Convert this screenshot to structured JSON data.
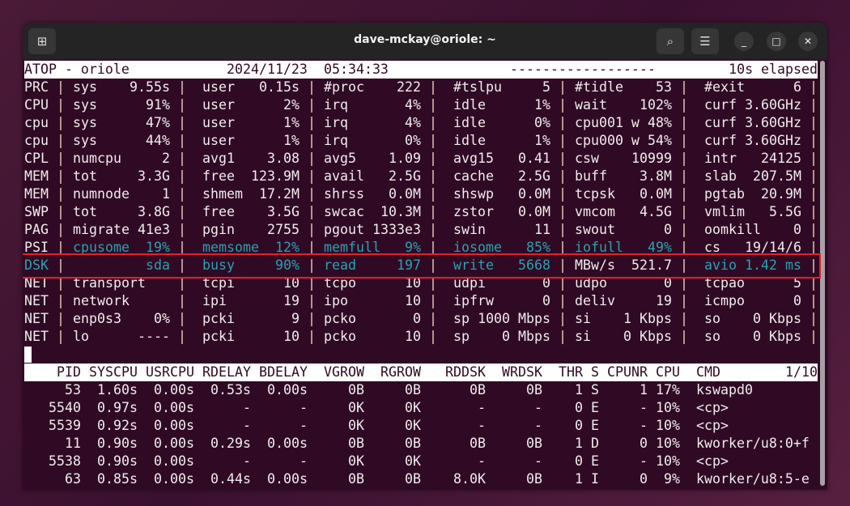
{
  "window": {
    "title": "dave-mckay@oriole: ~",
    "icons": {
      "new_tab": "new-tab-icon",
      "search": "search-icon",
      "menu": "hamburger-menu-icon",
      "minimize": "minimize-icon",
      "maximize": "maximize-icon",
      "close": "close-icon"
    }
  },
  "colors": {
    "terminal_bg": "#300a24",
    "highlight_text": "#2aa1b3",
    "annotation_box": "#e0202c"
  },
  "header": {
    "left": "ATOP - oriole",
    "date": "2024/11/23",
    "time": "05:34:33",
    "dashes": "------------------",
    "elapsed": "10s elapsed"
  },
  "system_rows": [
    {
      "label": "PRC",
      "cells": [
        [
          "sys",
          "9.55s"
        ],
        [
          "user",
          "0.15s"
        ],
        [
          "#proc",
          "222"
        ],
        [
          "#tslpu",
          "5"
        ],
        [
          "#tidle",
          "53"
        ],
        [
          "#exit",
          "6"
        ]
      ]
    },
    {
      "label": "CPU",
      "cells": [
        [
          "sys",
          "91%"
        ],
        [
          "user",
          "2%"
        ],
        [
          "irq",
          "4%"
        ],
        [
          "idle",
          "1%"
        ],
        [
          "wait",
          "102%"
        ],
        [
          "curf",
          "3.60GHz"
        ]
      ]
    },
    {
      "label": "cpu",
      "cells": [
        [
          "sys",
          "47%"
        ],
        [
          "user",
          "1%"
        ],
        [
          "irq",
          "4%"
        ],
        [
          "idle",
          "0%"
        ],
        [
          "cpu001 w",
          "48%"
        ],
        [
          "curf",
          "3.60GHz"
        ]
      ]
    },
    {
      "label": "cpu",
      "cells": [
        [
          "sys",
          "44%"
        ],
        [
          "user",
          "1%"
        ],
        [
          "irq",
          "0%"
        ],
        [
          "idle",
          "1%"
        ],
        [
          "cpu000 w",
          "54%"
        ],
        [
          "curf",
          "3.60GHz"
        ]
      ]
    },
    {
      "label": "CPL",
      "cells": [
        [
          "numcpu",
          "2"
        ],
        [
          "avg1",
          "3.08"
        ],
        [
          "avg5",
          "1.09"
        ],
        [
          "avg15",
          "0.41"
        ],
        [
          "csw",
          "10999"
        ],
        [
          "intr",
          "24125"
        ]
      ]
    },
    {
      "label": "MEM",
      "cells": [
        [
          "tot",
          "3.3G"
        ],
        [
          "free",
          "123.9M"
        ],
        [
          "avail",
          "2.5G"
        ],
        [
          "cache",
          "2.5G"
        ],
        [
          "buff",
          "3.8M"
        ],
        [
          "slab",
          "207.5M"
        ]
      ]
    },
    {
      "label": "MEM",
      "cells": [
        [
          "numnode",
          "1"
        ],
        [
          "shmem",
          "17.2M"
        ],
        [
          "shrss",
          "0.0M"
        ],
        [
          "shswp",
          "0.0M"
        ],
        [
          "tcpsk",
          "0.0M"
        ],
        [
          "pgtab",
          "20.9M"
        ]
      ]
    },
    {
      "label": "SWP",
      "cells": [
        [
          "tot",
          "3.8G"
        ],
        [
          "free",
          "3.5G"
        ],
        [
          "swcac",
          "10.3M"
        ],
        [
          "zstor",
          "0.0M"
        ],
        [
          "vmcom",
          "4.5G"
        ],
        [
          "vmlim",
          "5.5G"
        ]
      ]
    },
    {
      "label": "PAG",
      "cells": [
        [
          "migrate",
          "41e3"
        ],
        [
          "pgin",
          "2755"
        ],
        [
          "pgout",
          "1333e3"
        ],
        [
          "swin",
          "11"
        ],
        [
          "swout",
          "0"
        ],
        [
          "oomkill",
          "0"
        ]
      ]
    },
    {
      "label": "PSI",
      "cells": [
        [
          "cpusome",
          "19%",
          true
        ],
        [
          "memsome",
          "12%",
          true
        ],
        [
          "memfull",
          "9%",
          true
        ],
        [
          "iosome",
          "85%",
          true
        ],
        [
          "iofull",
          "49%",
          true
        ],
        [
          "cs",
          "19/14/6"
        ]
      ]
    },
    {
      "label": "DSK",
      "highlight": true,
      "cells": [
        [
          "",
          "sda",
          true
        ],
        [
          "busy",
          "90%",
          true
        ],
        [
          "read",
          "197",
          true
        ],
        [
          "write",
          "5668",
          true
        ],
        [
          "MBw/s",
          "521.7"
        ],
        [
          "avio",
          "1.42 ms",
          true
        ]
      ]
    },
    {
      "label": "NET",
      "cells": [
        [
          "transport",
          ""
        ],
        [
          "tcpi",
          "10"
        ],
        [
          "tcpo",
          "10"
        ],
        [
          "udpi",
          "0"
        ],
        [
          "udpo",
          "0"
        ],
        [
          "tcpao",
          "5"
        ]
      ]
    },
    {
      "label": "NET",
      "cells": [
        [
          "network",
          ""
        ],
        [
          "ipi",
          "19"
        ],
        [
          "ipo",
          "10"
        ],
        [
          "ipfrw",
          "0"
        ],
        [
          "deliv",
          "19"
        ],
        [
          "icmpo",
          "0"
        ]
      ]
    },
    {
      "label": "NET",
      "cells": [
        [
          "enp0s3",
          "0%"
        ],
        [
          "pcki",
          "9"
        ],
        [
          "pcko",
          "0"
        ],
        [
          "sp",
          "1000 Mbps"
        ],
        [
          "si",
          "1 Kbps"
        ],
        [
          "so",
          "0 Kbps"
        ]
      ]
    },
    {
      "label": "NET",
      "cells": [
        [
          "lo",
          "----"
        ],
        [
          "pcki",
          "10"
        ],
        [
          "pcko",
          "10"
        ],
        [
          "sp",
          "0 Mbps"
        ],
        [
          "si",
          "0 Kbps"
        ],
        [
          "so",
          "0 Kbps"
        ]
      ]
    }
  ],
  "process_table": {
    "columns": [
      "PID",
      "SYSCPU",
      "USRCPU",
      "RDELAY",
      "BDELAY",
      "VGROW",
      "RGROW",
      "RDDSK",
      "WRDSK",
      "THR",
      "S",
      "CPUNR",
      "CPU",
      "CMD"
    ],
    "page": "1/10",
    "rows": [
      [
        "53",
        "1.60s",
        "0.00s",
        "0.53s",
        "0.00s",
        "0B",
        "0B",
        "0B",
        "0B",
        "1",
        "S",
        "1",
        "17%",
        "kswapd0"
      ],
      [
        "5540",
        "0.97s",
        "0.00s",
        "-",
        "-",
        "0K",
        "0K",
        "-",
        "-",
        "0",
        "E",
        "-",
        "10%",
        "<cp>"
      ],
      [
        "5539",
        "0.92s",
        "0.00s",
        "-",
        "-",
        "0K",
        "0K",
        "-",
        "-",
        "0",
        "E",
        "-",
        "10%",
        "<cp>"
      ],
      [
        "11",
        "0.90s",
        "0.00s",
        "0.29s",
        "0.00s",
        "0B",
        "0B",
        "0B",
        "0B",
        "1",
        "D",
        "0",
        "10%",
        "kworker/u8:0+f"
      ],
      [
        "5538",
        "0.90s",
        "0.00s",
        "-",
        "-",
        "0K",
        "0K",
        "-",
        "-",
        "0",
        "E",
        "-",
        "10%",
        "<cp>"
      ],
      [
        "63",
        "0.85s",
        "0.00s",
        "0.44s",
        "0.00s",
        "0B",
        "0B",
        "8.0K",
        "0B",
        "1",
        "I",
        "0",
        "9%",
        "kworker/u8:5-e"
      ]
    ]
  }
}
